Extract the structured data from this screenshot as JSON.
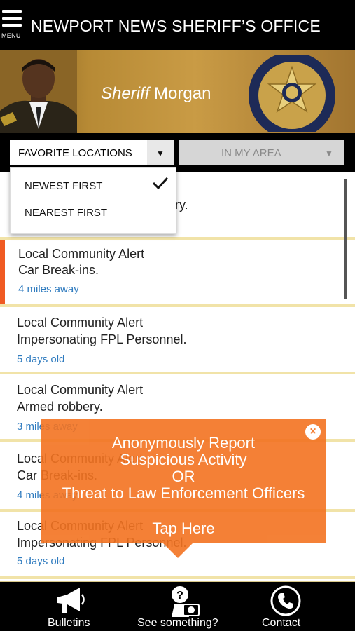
{
  "header": {
    "menu_label": "MENU",
    "title": "NEWPORT NEWS SHERIFF’S OFFICE"
  },
  "banner": {
    "title_prefix": "Sheriff",
    "title_name": "Morgan",
    "badge_text_ring": "NEWPORT NEWS SHERIFF'S OFFICE",
    "badge_word": "SHERIFF"
  },
  "filters": {
    "favorite_locations": "FAVORITE LOCATIONS",
    "in_my_area": "IN MY AREA",
    "arrow": "▼"
  },
  "sort_menu": {
    "options": [
      {
        "label": "NEWEST FIRST",
        "selected": true
      },
      {
        "label": "NEAREST FIRST",
        "selected": false
      }
    ]
  },
  "alerts": [
    {
      "title": "",
      "detail": "ry.",
      "meta": ""
    },
    {
      "title": "Local Community Alert",
      "detail": "Car Break-ins.",
      "meta": "4 miles away",
      "highlighted": true
    },
    {
      "title": "Local Community Alert",
      "detail": "Impersonating FPL Personnel.",
      "meta": "5 days old"
    },
    {
      "title": "Local Community Alert",
      "detail": "Armed robbery.",
      "meta": "3 miles away"
    },
    {
      "title": "Local Community Alert",
      "detail": "Car Break-ins.",
      "meta": "4 miles away"
    },
    {
      "title": "Local Community Alert",
      "detail": "Impersonating FPL Personnel.",
      "meta": "5 days old"
    }
  ],
  "popup": {
    "line1": "Anonymously Report",
    "line2": "Suspicious Activity",
    "line3": "OR",
    "line4": "Threat to Law Enforcement Officers",
    "cta": "Tap Here",
    "close": "×"
  },
  "tabbar": {
    "bulletins": "Bulletins",
    "see_something": "See something?",
    "contact": "Contact"
  },
  "colors": {
    "accent": "#f05a22",
    "popup": "#f37321",
    "meta_link": "#2f7bbf",
    "separator": "#f1e3a8"
  }
}
